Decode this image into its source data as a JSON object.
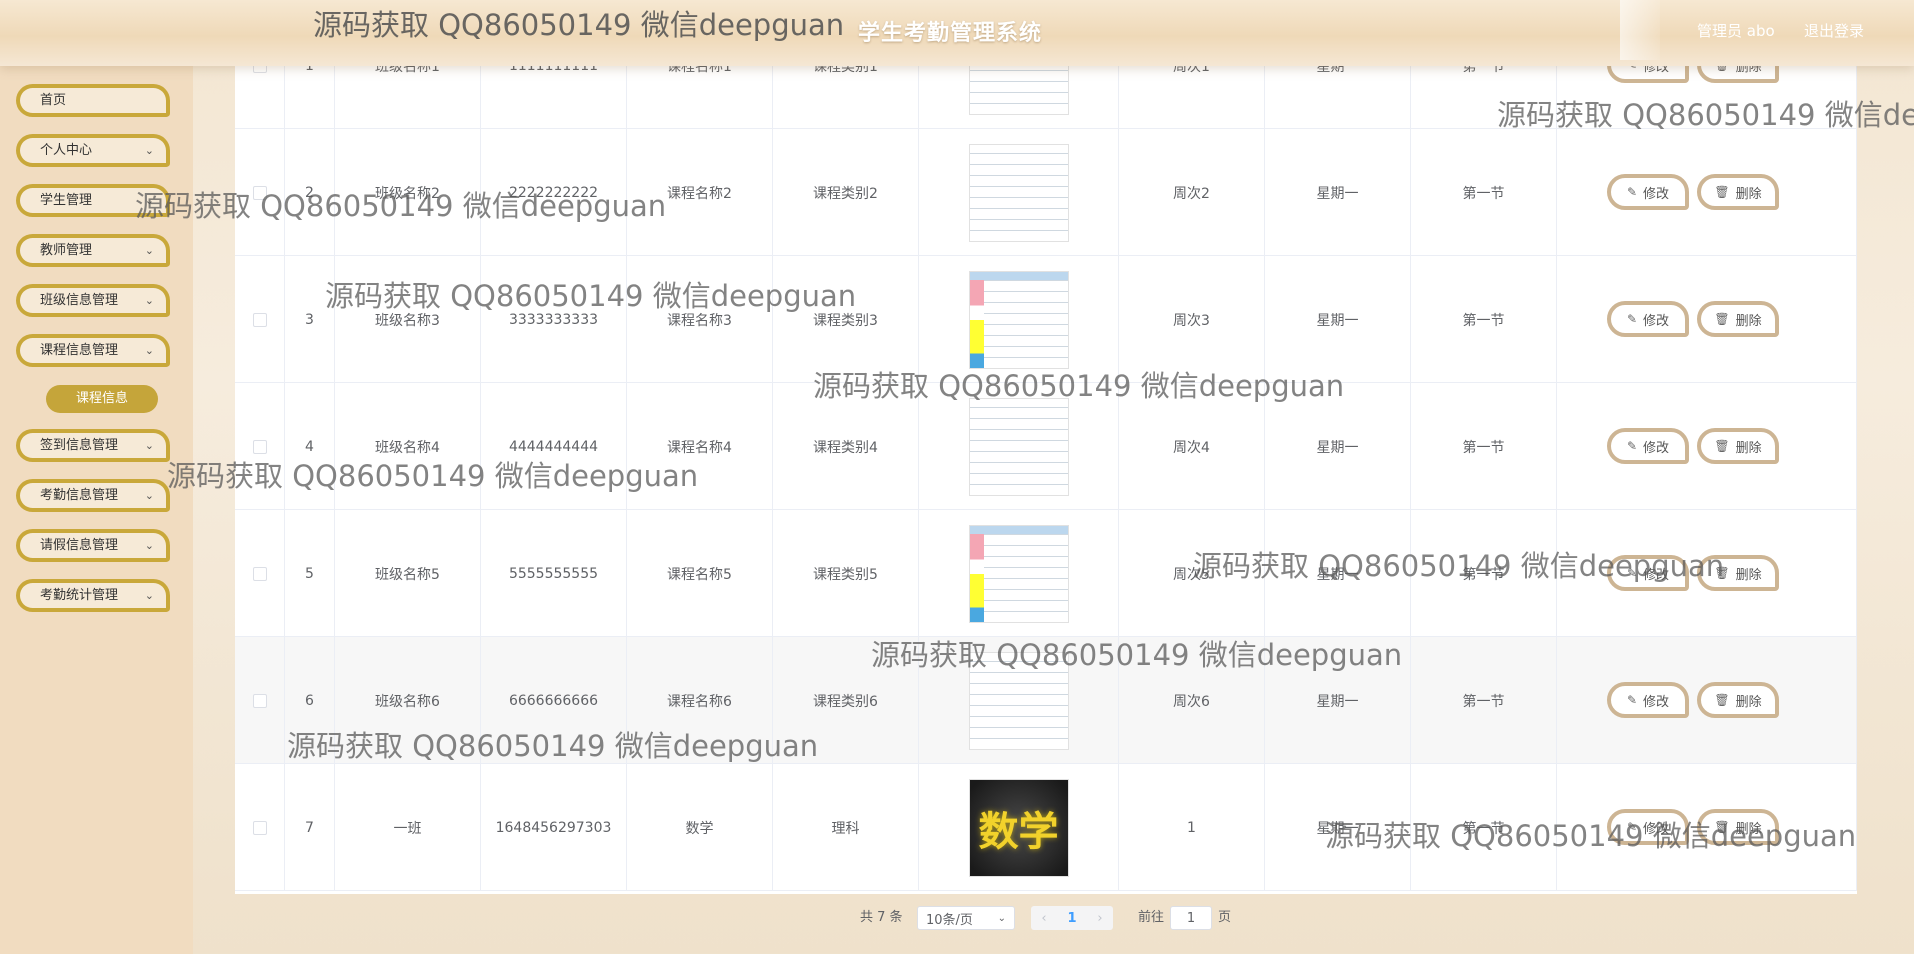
{
  "header": {
    "title": "学生考勤管理系统",
    "admin": "管理员 abo",
    "logout": "退出登录"
  },
  "sidebar": {
    "items": [
      {
        "label": "首页",
        "has_arrow": false
      },
      {
        "label": "个人中心",
        "has_arrow": true
      },
      {
        "label": "学生管理",
        "has_arrow": true
      },
      {
        "label": "教师管理",
        "has_arrow": true
      },
      {
        "label": "班级信息管理",
        "has_arrow": true
      },
      {
        "label": "课程信息管理",
        "has_arrow": true
      },
      {
        "label": "签到信息管理",
        "has_arrow": true
      },
      {
        "label": "考勤信息管理",
        "has_arrow": true
      },
      {
        "label": "请假信息管理",
        "has_arrow": true
      },
      {
        "label": "考勤统计管理",
        "has_arrow": true
      }
    ],
    "active_sub": "课程信息"
  },
  "table": {
    "rows": [
      {
        "index": "1",
        "class_name": "班级名称1",
        "code": "1111111111",
        "course_name": "课程名称1",
        "course_type": "课程类别1",
        "image": "schedule",
        "week": "周次1",
        "day": "星期一",
        "period": "第一节"
      },
      {
        "index": "2",
        "class_name": "班级名称2",
        "code": "2222222222",
        "course_name": "课程名称2",
        "course_type": "课程类别2",
        "image": "schedule",
        "week": "周次2",
        "day": "星期一",
        "period": "第一节"
      },
      {
        "index": "3",
        "class_name": "班级名称3",
        "code": "3333333333",
        "course_name": "课程名称3",
        "course_type": "课程类别3",
        "image": "schedule-colored",
        "week": "周次3",
        "day": "星期一",
        "period": "第一节"
      },
      {
        "index": "4",
        "class_name": "班级名称4",
        "code": "4444444444",
        "course_name": "课程名称4",
        "course_type": "课程类别4",
        "image": "schedule",
        "week": "周次4",
        "day": "星期一",
        "period": "第一节"
      },
      {
        "index": "5",
        "class_name": "班级名称5",
        "code": "5555555555",
        "course_name": "课程名称5",
        "course_type": "课程类别5",
        "image": "schedule-colored",
        "week": "周次5",
        "day": "星期一",
        "period": "第一节"
      },
      {
        "index": "6",
        "class_name": "班级名称6",
        "code": "6666666666",
        "course_name": "课程名称6",
        "course_type": "课程类别6",
        "image": "schedule",
        "week": "周次6",
        "day": "星期一",
        "period": "第一节"
      },
      {
        "index": "7",
        "class_name": "一班",
        "code": "1648456297303",
        "course_name": "数学",
        "course_type": "理科",
        "image": "math",
        "week": "1",
        "day": "星期一",
        "period": "第一节"
      }
    ],
    "edit_label": "修改",
    "delete_label": "删除",
    "math_image_text": "数学"
  },
  "pagination": {
    "total": "共 7 条",
    "page_size": "10条/页",
    "current_page": "1",
    "goto_label": "前往",
    "goto_value": "1",
    "page_unit": "页"
  },
  "watermark": {
    "text": "源码获取 QQ86050149 微信deepguan"
  },
  "colors": {
    "accent": "#c9a83a",
    "sidebar_bg": "#f1dcc0",
    "button_border": "#cdb594"
  }
}
